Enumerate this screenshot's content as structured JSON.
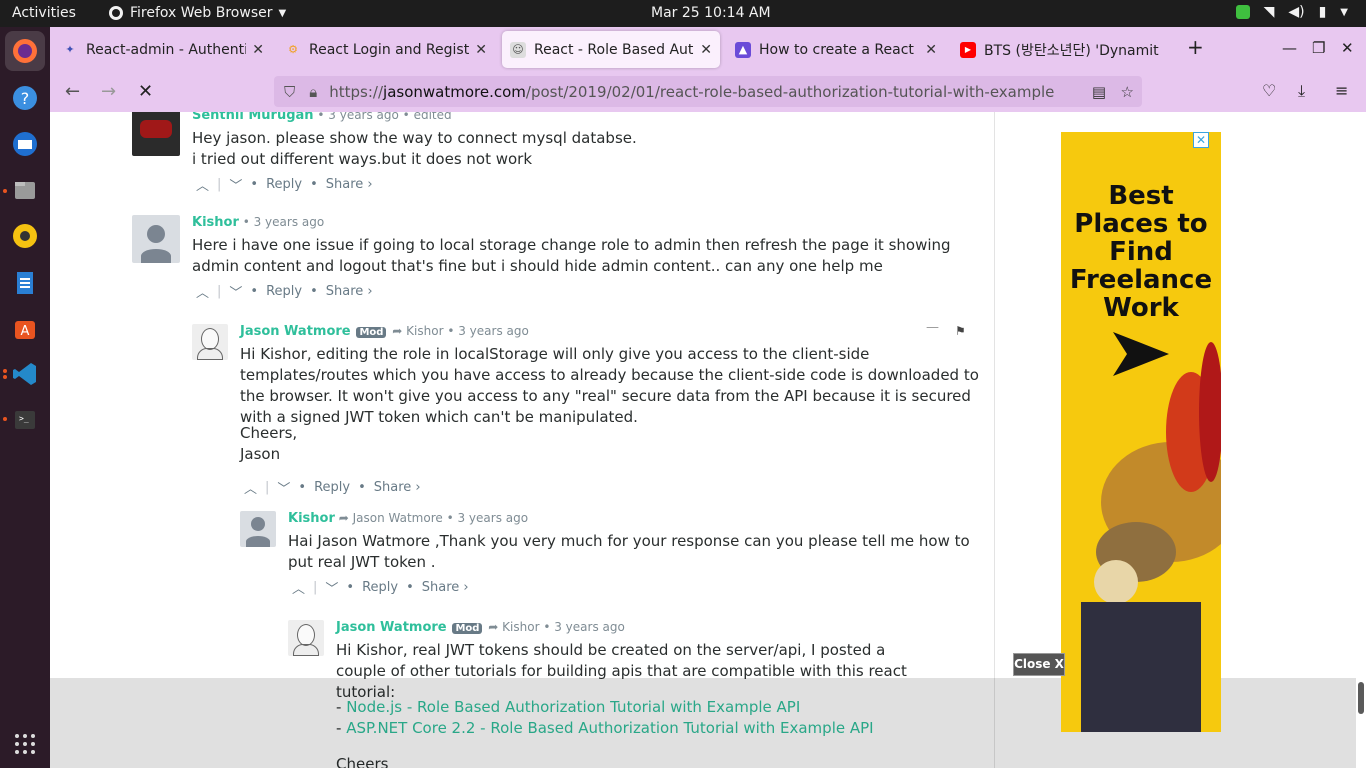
{
  "topbar": {
    "activities": "Activities",
    "app_name": "Firefox Web Browser",
    "clock": "Mar 25  10:14 AM"
  },
  "tabs": [
    {
      "title": "React-admin - Authentica",
      "favicon_color": "#3f51b5"
    },
    {
      "title": "React Login and Registrat",
      "favicon_color": "#f0a020"
    },
    {
      "title": "React - Role Based Autho",
      "favicon_color": "#888888"
    },
    {
      "title": "How to create a React ad",
      "favicon_color": "#6a4bd8"
    },
    {
      "title": "BTS (방탄소년단) 'Dynamit",
      "favicon_color": "#ff0000"
    }
  ],
  "url": {
    "scheme": "https://",
    "host": "jasonwatmore.com",
    "path": "/post/2019/02/01/react-role-based-authorization-tutorial-with-example"
  },
  "comments": {
    "c1": {
      "author": "Senthil Murugan",
      "meta": "• 3 years ago • edited",
      "lines": [
        "Hey jason. please show the way to connect mysql databse.",
        "i tried out different ways.but it does not work"
      ]
    },
    "c2": {
      "author": "Kishor",
      "meta": "• 3 years ago",
      "text": "Here i have one issue if going to local storage change role to admin then refresh the page it showing admin content and logout that's fine but i should hide admin content.. can any one help me"
    },
    "c3": {
      "author": "Jason Watmore",
      "badge": "Mod",
      "reply_to": "Kishor",
      "meta": "• 3 years ago",
      "text": "Hi Kishor, editing the role in localStorage will only give you access to the client-side templates/routes which you have access to already because the client-side code is downloaded to the browser. It won't give you access to any \"real\" secure data from the API because it is secured with a signed JWT token which can't be manipulated.",
      "sign1": "Cheers,",
      "sign2": "Jason"
    },
    "c4": {
      "author": "Kishor",
      "reply_to": "Jason Watmore",
      "meta": "• 3 years ago",
      "text": "Hai Jason Watmore ,Thank you very much for your response can you please tell me how to put real JWT token ."
    },
    "c5": {
      "author": "Jason Watmore",
      "badge": "Mod",
      "reply_to": "Kishor",
      "meta": "• 3 years ago",
      "text": "Hi Kishor, real JWT tokens should be created on the server/api, I posted a couple of other tutorials for building apis that are compatible with this react tutorial:",
      "link1": "Node.js - Role Based Authorization Tutorial with Example API",
      "link2": "ASP.NET Core 2.2 - Role Based Authorization Tutorial with Example API",
      "sign1": "Cheers"
    }
  },
  "actions": {
    "reply": "Reply",
    "share": "Share ›",
    "bullet": "•",
    "sep": "|"
  },
  "ad": {
    "headline": "Best Places to Find Freelance Work",
    "close_x": "✕",
    "close_button": "Close X"
  }
}
